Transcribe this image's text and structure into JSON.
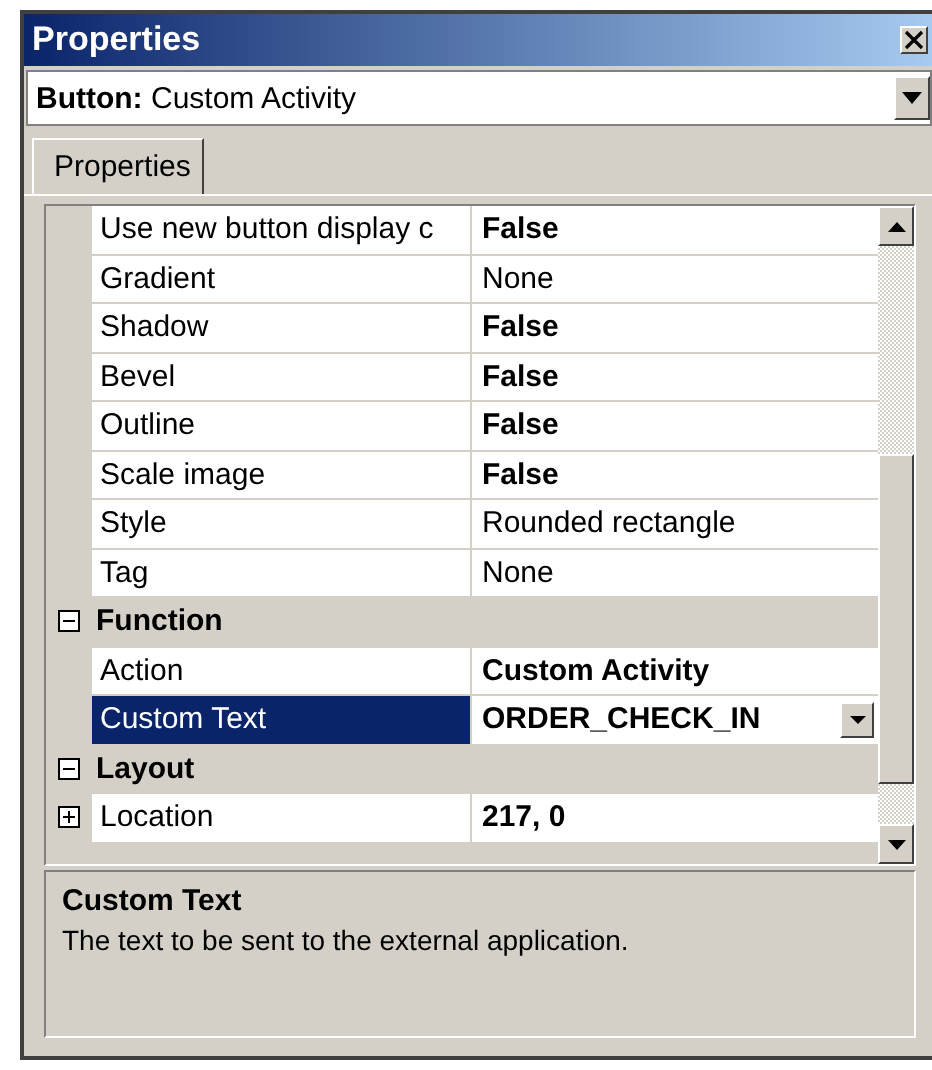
{
  "window": {
    "title": "Properties"
  },
  "object_selector": {
    "type_label": "Button:",
    "value": "Custom Activity"
  },
  "tabs": [
    {
      "label": "Properties",
      "selected": true
    }
  ],
  "grid": {
    "rows": [
      {
        "kind": "property",
        "name": "Use new button display c",
        "value": "False",
        "bold": true,
        "selected": false
      },
      {
        "kind": "property",
        "name": "Gradient",
        "value": "None",
        "bold": false,
        "selected": false
      },
      {
        "kind": "property",
        "name": "Shadow",
        "value": "False",
        "bold": true,
        "selected": false
      },
      {
        "kind": "property",
        "name": "Bevel",
        "value": "False",
        "bold": true,
        "selected": false
      },
      {
        "kind": "property",
        "name": "Outline",
        "value": "False",
        "bold": true,
        "selected": false
      },
      {
        "kind": "property",
        "name": "Scale image",
        "value": "False",
        "bold": true,
        "selected": false
      },
      {
        "kind": "property",
        "name": "Style",
        "value": "Rounded rectangle",
        "bold": false,
        "selected": false
      },
      {
        "kind": "property",
        "name": "Tag",
        "value": "None",
        "bold": false,
        "selected": false
      },
      {
        "kind": "category",
        "name": "Function",
        "expanded": true
      },
      {
        "kind": "property",
        "name": "Action",
        "value": "Custom Activity",
        "bold": true,
        "selected": false
      },
      {
        "kind": "property",
        "name": "Custom Text",
        "value": "ORDER_CHECK_IN",
        "bold": true,
        "selected": true
      },
      {
        "kind": "category",
        "name": "Layout",
        "expanded": true
      },
      {
        "kind": "property",
        "name": "Location",
        "value": "217, 0",
        "bold": true,
        "selected": false,
        "expanded": false
      }
    ]
  },
  "description": {
    "title": "Custom Text",
    "text": "The text to be sent to the external application."
  }
}
